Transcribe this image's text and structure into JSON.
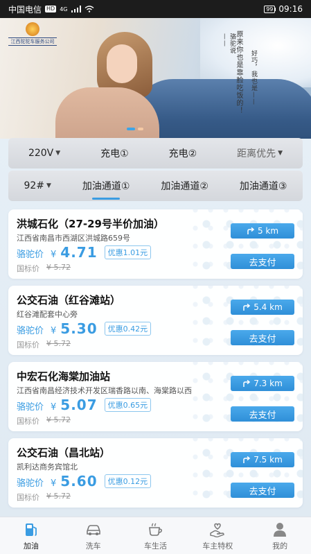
{
  "status_bar": {
    "carrier": "中国电信",
    "hd": "HD",
    "network": "4G",
    "battery": "99",
    "time": "09:16"
  },
  "banner": {
    "logo_text": "江西驼驼车服务公司",
    "vertical_text_1": "骆驼说——",
    "vertical_text_2": "原来你也是靠脸吃饭的！",
    "vertical_text_3": "好巧，我也是——"
  },
  "filter_row_1": {
    "voltage": "220V",
    "charge_1": "充电①",
    "charge_2": "充电②",
    "sort": "距离优先"
  },
  "filter_row_2": {
    "fuel": "92#",
    "channel_1": "加油通道①",
    "channel_2": "加油通道②",
    "channel_3": "加油通道③"
  },
  "labels": {
    "price_label": "骆驼价",
    "yen": "¥",
    "ref_label": "国标价",
    "pay_button": "去支付"
  },
  "stations": [
    {
      "name": "洪城石化（27-29号半价加油）",
      "address": "江西省南昌市西湖区洪城路659号",
      "price": "4.71",
      "discount": "优惠1.01元",
      "ref_price": "¥ 5.72",
      "distance": "5 km"
    },
    {
      "name": "公交石油（红谷滩站）",
      "address": "红谷滩配套中心旁",
      "price": "5.30",
      "discount": "优惠0.42元",
      "ref_price": "¥ 5.72",
      "distance": "5.4 km"
    },
    {
      "name": "中宏石化海棠加油站",
      "address": "江西省南昌经济技术开发区瑞香路以南、海棠路以西",
      "price": "5.07",
      "discount": "优惠0.65元",
      "ref_price": "¥ 5.72",
      "distance": "7.3 km"
    },
    {
      "name": "公交石油（昌北站）",
      "address": "凯利达商务宾馆北",
      "price": "5.60",
      "discount": "优惠0.12元",
      "ref_price": "¥ 5.72",
      "distance": "7.5 km"
    }
  ],
  "tabs": [
    {
      "label": "加油",
      "icon": "fuel-pump-icon"
    },
    {
      "label": "洗车",
      "icon": "car-icon"
    },
    {
      "label": "车生活",
      "icon": "coffee-cup-icon"
    },
    {
      "label": "车主特权",
      "icon": "hand-heart-icon"
    },
    {
      "label": "我的",
      "icon": "user-icon"
    }
  ],
  "colors": {
    "accent": "#3a9ce2",
    "status_bar": "#1c1c1c"
  }
}
